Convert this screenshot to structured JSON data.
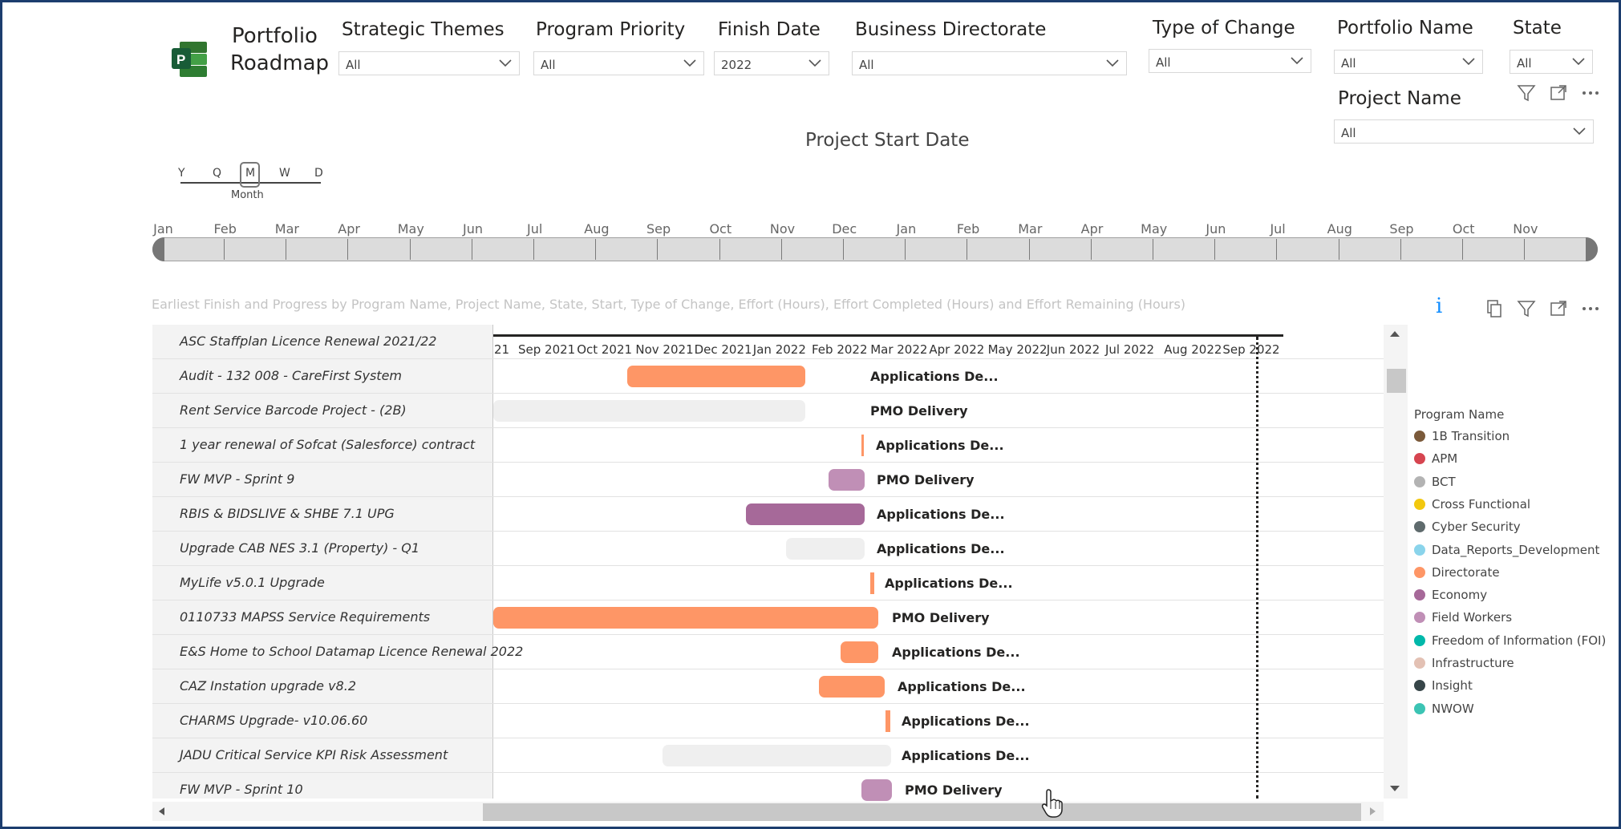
{
  "header": {
    "title_line1": "Portfolio",
    "title_line2": "Roadmap"
  },
  "slicers": [
    {
      "title": "Strategic Themes",
      "value": "All"
    },
    {
      "title": "Program Priority",
      "value": "All"
    },
    {
      "title": "Finish Date",
      "value": "2022"
    },
    {
      "title": "Business Directorate",
      "value": "All"
    },
    {
      "title": "Type of Change",
      "value": "All"
    },
    {
      "title": "Portfolio Name",
      "value": "All"
    },
    {
      "title": "State",
      "value": "All"
    },
    {
      "title": "Project Name",
      "value": "All"
    }
  ],
  "timeline": {
    "title": "Project Start Date",
    "granularity": [
      "Y",
      "Q",
      "M",
      "W",
      "D"
    ],
    "selected_granularity": "M",
    "selected_label": "Month",
    "months": [
      "Jan",
      "Feb",
      "Mar",
      "Apr",
      "May",
      "Jun",
      "Jul",
      "Aug",
      "Sep",
      "Oct",
      "Nov",
      "Dec",
      "Jan",
      "Feb",
      "Mar",
      "Apr",
      "May",
      "Jun",
      "Jul",
      "Aug",
      "Sep",
      "Oct",
      "Nov"
    ]
  },
  "gantt": {
    "caption": "Earliest Finish and Progress by Program Name, Project Name, State, Start, Type of Change, Effort (Hours), Effort Completed (Hours) and Effort Remaining (Hours)",
    "axis_ticks": [
      "21",
      "Sep 2021",
      "Oct 2021",
      "Nov 2021",
      "Dec 2021",
      "Jan 2022",
      "Feb 2022",
      "Mar 2022",
      "Apr 2022",
      "May 2022",
      "Jun 2022",
      "Jul 2022",
      "Aug 2022",
      "Sep 2022"
    ],
    "rows": [
      {
        "name": "ASC Staffplan Licence Renewal 2021/22",
        "label": ""
      },
      {
        "name": "Audit - 132 008 - CareFirst System",
        "label": "Applications De..."
      },
      {
        "name": "Rent Service Barcode Project - (2B)",
        "label": "PMO Delivery"
      },
      {
        "name": "1 year renewal of Sofcat (Salesforce) contract",
        "label": "Applications De..."
      },
      {
        "name": "FW MVP - Sprint 9",
        "label": "PMO Delivery"
      },
      {
        "name": "RBIS & BIDSLIVE & SHBE 7.1 UPG",
        "label": "Applications De..."
      },
      {
        "name": "Upgrade CAB NES 3.1 (Property) - Q1",
        "label": "Applications De..."
      },
      {
        "name": "MyLife v5.0.1 Upgrade",
        "label": "Applications De..."
      },
      {
        "name": "0110733 MAPSS Service Requirements",
        "label": "PMO Delivery"
      },
      {
        "name": "E&S Home to School Datamap Licence Renewal 2022",
        "label": "Applications De..."
      },
      {
        "name": "CAZ Instation upgrade v8.2",
        "label": "Applications De..."
      },
      {
        "name": "CHARMS Upgrade- v10.06.60",
        "label": "Applications De..."
      },
      {
        "name": "JADU Critical Service KPI Risk Assessment",
        "label": "Applications De..."
      },
      {
        "name": "FW MVP - Sprint 10",
        "label": "PMO Delivery"
      }
    ]
  },
  "legend": {
    "title": "Program Name",
    "items": [
      {
        "name": "1B Transition",
        "color": "#7b5a3a"
      },
      {
        "name": "APM",
        "color": "#d64550"
      },
      {
        "name": "BCT",
        "color": "#b3b3b3"
      },
      {
        "name": "Cross Functional",
        "color": "#f2c80f"
      },
      {
        "name": "Cyber Security",
        "color": "#5f6b6d"
      },
      {
        "name": "Data_Reports_Development",
        "color": "#8ad4eb"
      },
      {
        "name": "Directorate",
        "color": "#fe9666"
      },
      {
        "name": "Economy",
        "color": "#a66999"
      },
      {
        "name": "Field Workers",
        "color": "#c08fb6"
      },
      {
        "name": "Freedom of Information (FOI)",
        "color": "#01b8aa"
      },
      {
        "name": "Infrastructure",
        "color": "#e3c1b4"
      },
      {
        "name": "Insight",
        "color": "#374649"
      },
      {
        "name": "NWOW",
        "color": "#3cc4b4"
      }
    ]
  }
}
